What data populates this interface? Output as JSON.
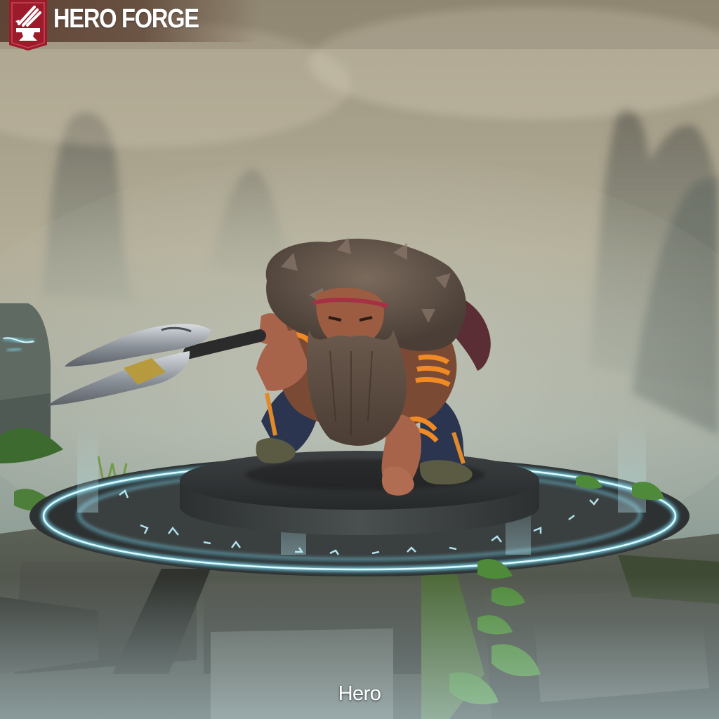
{
  "brand": {
    "name": "HERO FORGE",
    "logo_icon": "anvil-sword-icon",
    "logo_color": "#9b1b2b"
  },
  "viewer": {
    "caption": "Hero",
    "rune_glow_color": "#7fe6ff",
    "base_color": "#2f3234"
  }
}
